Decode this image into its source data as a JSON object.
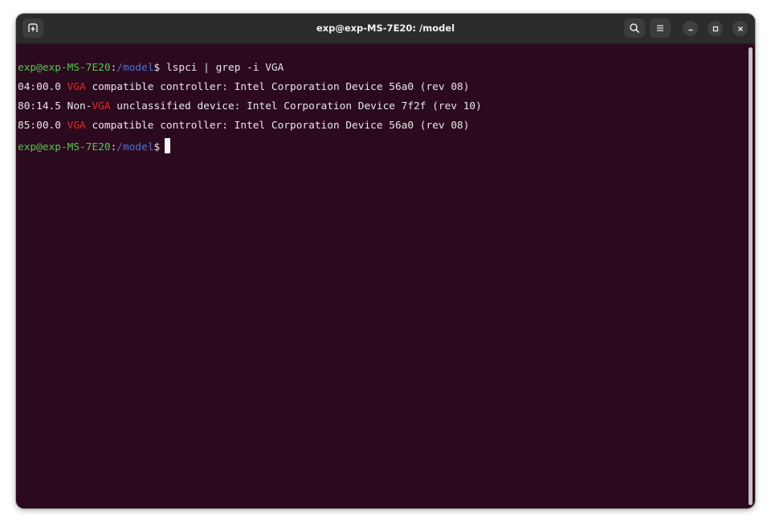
{
  "window": {
    "title": "exp@exp-MS-7E20: /model"
  },
  "icons": {
    "new_tab": "new-tab-icon",
    "search": "search-icon",
    "menu": "hamburger-menu-icon",
    "minimize": "minimize-icon",
    "maximize": "maximize-icon",
    "close": "close-icon"
  },
  "colors": {
    "terminal_bg": "#2c0a1e",
    "prompt_user": "#4ec94e",
    "prompt_path": "#4a73d9",
    "grep_match": "#e02828",
    "text": "#e6e6e6"
  },
  "terminal": {
    "prompt_user": "exp@exp-MS-7E20",
    "prompt_colon": ":",
    "prompt_path": "/model",
    "prompt_symbol": "$",
    "command": " lspci | grep -i VGA",
    "output": [
      {
        "pre": "04:00.0 ",
        "match": "VGA",
        "post": " compatible controller: Intel Corporation Device 56a0 (rev 08)"
      },
      {
        "pre": "80:14.5 Non-",
        "match": "VGA",
        "post": " unclassified device: Intel Corporation Device 7f2f (rev 10)"
      },
      {
        "pre": "85:00.0 ",
        "match": "VGA",
        "post": " compatible controller: Intel Corporation Device 56a0 (rev 08)"
      }
    ]
  }
}
